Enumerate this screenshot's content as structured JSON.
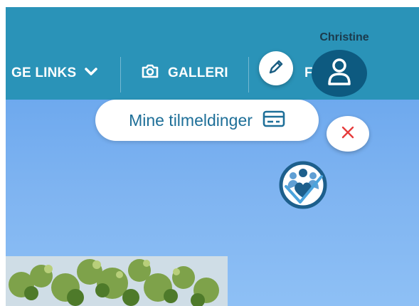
{
  "nav": {
    "links_label": "GE LINKS",
    "galleri_label": "GALLERI",
    "partial_label": "FE"
  },
  "user": {
    "name": "Christine"
  },
  "tooltip": {
    "label": "Mine tilmeldinger"
  },
  "icons": {
    "links_dropdown": "chevron-down-icon",
    "galleri": "camera-icon",
    "edit": "pencil-icon",
    "avatar": "user-icon",
    "tooltip": "credit-card-icon",
    "close": "close-icon",
    "logo": "people-heart-logo"
  },
  "colors": {
    "navbar": "#2a93b8",
    "avatar": "#0d5a80",
    "tooltip_text": "#1e6f98",
    "close_x": "#e63b3b",
    "sky_top": "#6ea9ee",
    "sky_bottom": "#8ec0f5"
  }
}
